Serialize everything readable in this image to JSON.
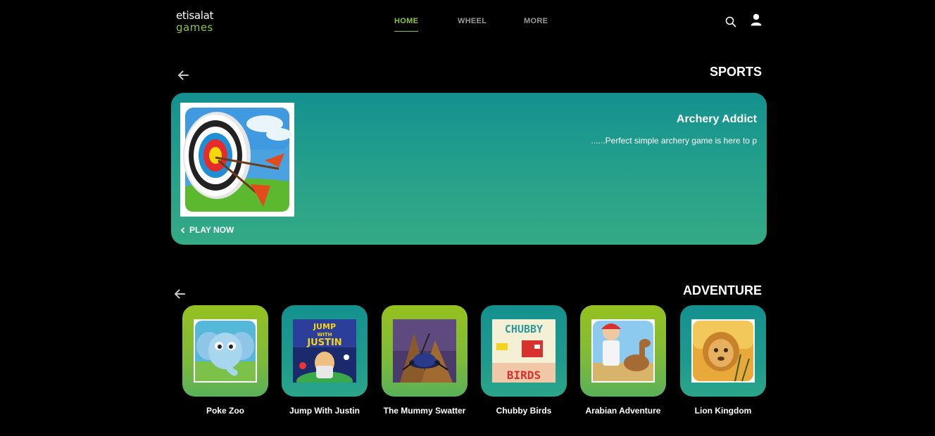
{
  "brand": {
    "line1": "etisalat",
    "line2": "games"
  },
  "nav": {
    "items": [
      {
        "label": "HOME",
        "active": true
      },
      {
        "label": "WHEEL",
        "active": false
      },
      {
        "label": "MORE",
        "active": false
      }
    ]
  },
  "icons": {
    "search": "search-icon",
    "user": "user-icon",
    "back": "arrow-left-icon",
    "play": "chevron-left-icon"
  },
  "sports": {
    "title": "SPORTS",
    "featured": {
      "title": "Archery Addict",
      "description": "......Perfect simple archery game is here to p",
      "cta": "PLAY NOW"
    }
  },
  "adventure": {
    "title": "ADVENTURE",
    "games": [
      {
        "name": "Poke Zoo"
      },
      {
        "name": "Jump With Justin"
      },
      {
        "name": "The Mummy Swatter"
      },
      {
        "name": "Chubby Birds"
      },
      {
        "name": "Arabian Adventure"
      },
      {
        "name": "Lion Kingdom"
      }
    ]
  },
  "colors": {
    "accent": "#8bc53f",
    "teal": "#14918f",
    "green": "#96c11f",
    "background": "#000000"
  }
}
